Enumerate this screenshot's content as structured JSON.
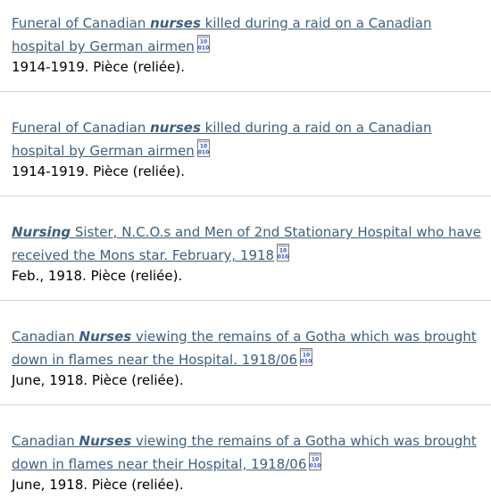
{
  "results": [
    {
      "title_parts": [
        "Funeral of Canadian ",
        "nurses",
        " killed during a raid on a Canadian hospital by German airmen"
      ],
      "icon": "digital-object-icon",
      "meta": "1914-1919. Pièce (reliée)."
    },
    {
      "title_parts": [
        "Funeral of Canadian ",
        "nurses",
        " killed during a raid on a Canadian hospital by German airmen"
      ],
      "icon": "digital-object-icon",
      "meta": "1914-1919. Pièce (reliée)."
    },
    {
      "title_parts": [
        "",
        "Nursing",
        " Sister, N.C.O.s and Men of 2nd Stationary Hospital who have received the Mons star. February, 1918"
      ],
      "icon": "digital-object-icon",
      "meta": "Feb., 1918. Pièce (reliée)."
    },
    {
      "title_parts": [
        "Canadian ",
        "Nurses",
        " viewing the remains of a Gotha which was brought down in flames near the Hospital. 1918/06"
      ],
      "icon": "digital-object-icon",
      "meta": "June, 1918. Pièce (reliée)."
    },
    {
      "title_parts": [
        "Canadian ",
        "Nurses",
        " viewing the remains of a Gotha which was brought down in flames near their Hospital, 1918/06"
      ],
      "icon": "digital-object-icon",
      "meta": "June, 1918. Pièce (reliée)."
    }
  ],
  "colors": {
    "link": "#3e5f7d",
    "icon_blue": "#2b4fd8",
    "divider": "#d3d3d3"
  }
}
